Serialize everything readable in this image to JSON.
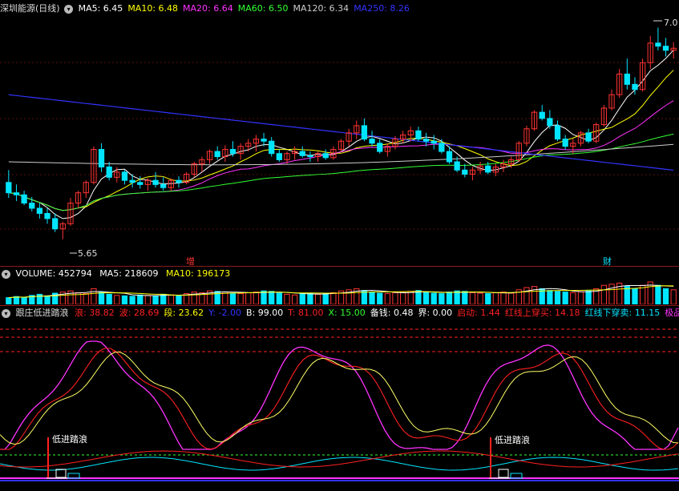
{
  "price_header": {
    "name": "深圳能源",
    "period": "(日线)",
    "ma": [
      {
        "label": "MA5: 6.45",
        "color": "#ffffff"
      },
      {
        "label": "MA10: 6.48",
        "color": "#ffff00"
      },
      {
        "label": "MA20: 6.64",
        "color": "#ff33ff"
      },
      {
        "label": "MA60: 6.50",
        "color": "#33ff33"
      },
      {
        "label": "MA120: 6.34",
        "color": "#cccccc"
      },
      {
        "label": "MA250: 8.26",
        "color": "#3333ff"
      }
    ]
  },
  "price_annotations": {
    "high_label": "7.0",
    "low_label": "5.65",
    "event1": "增",
    "event2": "财"
  },
  "volume_header": {
    "title": "VOLUME: 452794",
    "ma5": "MA5: 218609",
    "ma10": "MA10: 196173",
    "colors": {
      "title": "#ffffff",
      "ma5": "#ffffff",
      "ma10": "#ffff00"
    }
  },
  "indicator_header": {
    "name": "跟庄低进踏浪",
    "items": [
      {
        "label": "浪: 38.82",
        "color": "#ff2020"
      },
      {
        "label": "波: 28.69",
        "color": "#ff2020"
      },
      {
        "label": "段: 23.62",
        "color": "#ffff00"
      },
      {
        "label": "Y: -2.00",
        "color": "#3333ff"
      },
      {
        "label": "B: 99.00",
        "color": "#ffffff"
      },
      {
        "label": "T: 81.00",
        "color": "#ff2020"
      },
      {
        "label": "X: 15.00",
        "color": "#33ff33"
      },
      {
        "label": "备钱: 0.48",
        "color": "#ffffff"
      },
      {
        "label": "界: 0.00",
        "color": "#ffffff"
      },
      {
        "label": "启动: 1.44",
        "color": "#ff2020"
      },
      {
        "label": "红线上穿买: 14.18",
        "color": "#ff2020"
      },
      {
        "label": "红线下穿卖: 11.15",
        "color": "#00e5ff"
      },
      {
        "label": "极品",
        "color": "#ff33ff"
      }
    ]
  },
  "indicator_markers": [
    "低进踏浪",
    "低进踏浪"
  ],
  "colors": {
    "up": "#ff3333",
    "down": "#00e5ff",
    "separator": "#8a1a1a"
  },
  "chart_data": {
    "type": "candlestick",
    "candles": [
      [
        6.2,
        6.32,
        6.05,
        6.1
      ],
      [
        6.1,
        6.18,
        6.02,
        6.08
      ],
      [
        6.08,
        6.12,
        5.98,
        6.0
      ],
      [
        6.0,
        6.06,
        5.92,
        5.95
      ],
      [
        5.95,
        6.0,
        5.85,
        5.9
      ],
      [
        5.9,
        5.95,
        5.8,
        5.85
      ],
      [
        5.85,
        5.9,
        5.72,
        5.75
      ],
      [
        5.75,
        5.82,
        5.65,
        5.8
      ],
      [
        5.8,
        6.05,
        5.78,
        6.0
      ],
      [
        6.0,
        6.12,
        5.95,
        6.1
      ],
      [
        6.1,
        6.22,
        6.05,
        6.2
      ],
      [
        6.2,
        6.55,
        6.18,
        6.52
      ],
      [
        6.52,
        6.58,
        6.3,
        6.35
      ],
      [
        6.35,
        6.4,
        6.22,
        6.25
      ],
      [
        6.25,
        6.35,
        6.2,
        6.3
      ],
      [
        6.3,
        6.32,
        6.18,
        6.22
      ],
      [
        6.22,
        6.28,
        6.15,
        6.2
      ],
      [
        6.2,
        6.26,
        6.14,
        6.18
      ],
      [
        6.18,
        6.24,
        6.12,
        6.22
      ],
      [
        6.22,
        6.3,
        6.15,
        6.18
      ],
      [
        6.18,
        6.25,
        6.12,
        6.15
      ],
      [
        6.15,
        6.24,
        6.12,
        6.22
      ],
      [
        6.22,
        6.26,
        6.15,
        6.2
      ],
      [
        6.2,
        6.3,
        6.18,
        6.28
      ],
      [
        6.28,
        6.4,
        6.25,
        6.38
      ],
      [
        6.38,
        6.45,
        6.3,
        6.42
      ],
      [
        6.42,
        6.52,
        6.38,
        6.5
      ],
      [
        6.5,
        6.55,
        6.42,
        6.45
      ],
      [
        6.45,
        6.56,
        6.4,
        6.52
      ],
      [
        6.52,
        6.6,
        6.45,
        6.48
      ],
      [
        6.48,
        6.58,
        6.42,
        6.55
      ],
      [
        6.55,
        6.62,
        6.5,
        6.58
      ],
      [
        6.58,
        6.66,
        6.5,
        6.62
      ],
      [
        6.62,
        6.68,
        6.55,
        6.6
      ],
      [
        6.6,
        6.64,
        6.45,
        6.48
      ],
      [
        6.48,
        6.52,
        6.4,
        6.42
      ],
      [
        6.42,
        6.5,
        6.38,
        6.48
      ],
      [
        6.48,
        6.55,
        6.42,
        6.5
      ],
      [
        6.5,
        6.55,
        6.44,
        6.46
      ],
      [
        6.46,
        6.5,
        6.4,
        6.45
      ],
      [
        6.45,
        6.5,
        6.4,
        6.48
      ],
      [
        6.48,
        6.52,
        6.42,
        6.44
      ],
      [
        6.44,
        6.55,
        6.42,
        6.52
      ],
      [
        6.52,
        6.62,
        6.5,
        6.6
      ],
      [
        6.6,
        6.72,
        6.55,
        6.68
      ],
      [
        6.68,
        6.8,
        6.62,
        6.75
      ],
      [
        6.75,
        6.82,
        6.6,
        6.62
      ],
      [
        6.62,
        6.7,
        6.55,
        6.58
      ],
      [
        6.58,
        6.62,
        6.48,
        6.5
      ],
      [
        6.5,
        6.58,
        6.45,
        6.55
      ],
      [
        6.55,
        6.65,
        6.52,
        6.62
      ],
      [
        6.62,
        6.7,
        6.58,
        6.66
      ],
      [
        6.66,
        6.74,
        6.6,
        6.7
      ],
      [
        6.7,
        6.74,
        6.6,
        6.62
      ],
      [
        6.62,
        6.68,
        6.55,
        6.6
      ],
      [
        6.6,
        6.66,
        6.52,
        6.58
      ],
      [
        6.58,
        6.62,
        6.48,
        6.5
      ],
      [
        6.5,
        6.55,
        6.38,
        6.4
      ],
      [
        6.4,
        6.45,
        6.3,
        6.32
      ],
      [
        6.32,
        6.38,
        6.25,
        6.28
      ],
      [
        6.28,
        6.35,
        6.22,
        6.32
      ],
      [
        6.32,
        6.4,
        6.28,
        6.36
      ],
      [
        6.36,
        6.4,
        6.28,
        6.3
      ],
      [
        6.3,
        6.38,
        6.26,
        6.35
      ],
      [
        6.35,
        6.42,
        6.3,
        6.38
      ],
      [
        6.38,
        6.45,
        6.34,
        6.42
      ],
      [
        6.42,
        6.6,
        6.4,
        6.58
      ],
      [
        6.58,
        6.75,
        6.55,
        6.72
      ],
      [
        6.72,
        6.9,
        6.7,
        6.88
      ],
      [
        6.88,
        6.95,
        6.8,
        6.82
      ],
      [
        6.82,
        6.9,
        6.72,
        6.75
      ],
      [
        6.75,
        6.8,
        6.6,
        6.62
      ],
      [
        6.62,
        6.66,
        6.52,
        6.55
      ],
      [
        6.55,
        6.62,
        6.48,
        6.58
      ],
      [
        6.58,
        6.7,
        6.55,
        6.68
      ],
      [
        6.68,
        6.72,
        6.58,
        6.6
      ],
      [
        6.6,
        6.78,
        6.58,
        6.76
      ],
      [
        6.76,
        6.95,
        6.74,
        6.92
      ],
      [
        6.92,
        7.1,
        6.9,
        7.05
      ],
      [
        7.05,
        7.3,
        7.02,
        7.25
      ],
      [
        7.25,
        7.4,
        7.1,
        7.15
      ],
      [
        7.15,
        7.22,
        7.05,
        7.1
      ],
      [
        7.1,
        7.4,
        7.08,
        7.36
      ],
      [
        7.36,
        7.62,
        7.3,
        7.55
      ],
      [
        7.55,
        7.7,
        7.48,
        7.52
      ],
      [
        7.52,
        7.6,
        7.42,
        7.48
      ],
      [
        7.48,
        7.56,
        7.4,
        7.5
      ]
    ],
    "price_range": [
      5.5,
      7.75
    ],
    "volume": [
      0.3,
      0.35,
      0.32,
      0.4,
      0.45,
      0.38,
      0.5,
      0.55,
      0.6,
      0.52,
      0.48,
      0.7,
      0.55,
      0.45,
      0.4,
      0.38,
      0.36,
      0.42,
      0.4,
      0.38,
      0.45,
      0.42,
      0.4,
      0.48,
      0.55,
      0.52,
      0.6,
      0.58,
      0.55,
      0.5,
      0.48,
      0.52,
      0.55,
      0.6,
      0.58,
      0.5,
      0.45,
      0.42,
      0.48,
      0.5,
      0.45,
      0.48,
      0.52,
      0.6,
      0.65,
      0.7,
      0.62,
      0.55,
      0.5,
      0.48,
      0.52,
      0.55,
      0.58,
      0.62,
      0.55,
      0.5,
      0.48,
      0.55,
      0.6,
      0.58,
      0.52,
      0.5,
      0.48,
      0.52,
      0.55,
      0.5,
      0.65,
      0.75,
      0.8,
      0.7,
      0.62,
      0.58,
      0.55,
      0.52,
      0.56,
      0.6,
      0.7,
      0.85,
      0.9,
      0.95,
      0.8,
      0.7,
      0.85,
      1.0,
      0.85,
      0.7,
      0.65
    ],
    "volume_up": [
      false,
      false,
      false,
      false,
      false,
      false,
      false,
      true,
      true,
      true,
      true,
      true,
      false,
      false,
      true,
      false,
      false,
      false,
      true,
      false,
      false,
      true,
      false,
      true,
      true,
      true,
      true,
      false,
      true,
      false,
      true,
      true,
      true,
      false,
      false,
      false,
      true,
      true,
      false,
      false,
      true,
      false,
      true,
      true,
      true,
      true,
      false,
      false,
      false,
      true,
      true,
      true,
      true,
      false,
      false,
      false,
      false,
      false,
      false,
      false,
      true,
      true,
      false,
      true,
      true,
      true,
      true,
      true,
      true,
      false,
      false,
      false,
      false,
      true,
      true,
      false,
      true,
      true,
      true,
      true,
      false,
      false,
      true,
      true,
      false,
      false,
      true
    ]
  }
}
